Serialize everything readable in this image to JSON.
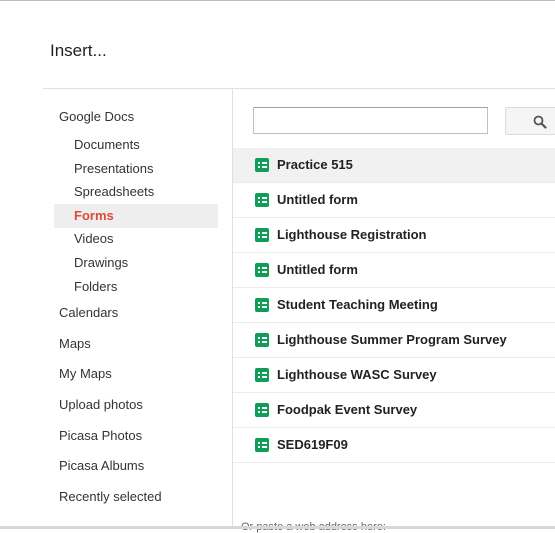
{
  "dialog": {
    "title": "Insert..."
  },
  "sidebar": {
    "section_label": "Google Docs",
    "sub_items": [
      {
        "label": "Documents"
      },
      {
        "label": "Presentations"
      },
      {
        "label": "Spreadsheets"
      },
      {
        "label": "Forms",
        "active": true
      },
      {
        "label": "Videos"
      },
      {
        "label": "Drawings"
      },
      {
        "label": "Folders"
      }
    ],
    "top_items": [
      {
        "label": "Calendars"
      },
      {
        "label": "Maps"
      },
      {
        "label": "My Maps"
      },
      {
        "label": "Upload photos"
      },
      {
        "label": "Picasa Photos"
      },
      {
        "label": "Picasa Albums"
      },
      {
        "label": "Recently selected"
      }
    ]
  },
  "search": {
    "value": "",
    "button_icon": "search-icon"
  },
  "files": [
    {
      "name": "Practice 515",
      "selected": true,
      "icon": "form-icon"
    },
    {
      "name": "Untitled form",
      "icon": "form-icon"
    },
    {
      "name": "Lighthouse Registration",
      "icon": "form-icon"
    },
    {
      "name": "Untitled form",
      "icon": "form-icon"
    },
    {
      "name": "Student Teaching Meeting",
      "icon": "form-icon"
    },
    {
      "name": "Lighthouse Summer Program Survey",
      "icon": "form-icon"
    },
    {
      "name": "Lighthouse WASC Survey",
      "icon": "form-icon"
    },
    {
      "name": "Foodpak Event Survey",
      "icon": "form-icon"
    },
    {
      "name": "SED619F09",
      "icon": "form-icon"
    }
  ],
  "footer": {
    "paste_hint": "Or paste a web address here:"
  },
  "colors": {
    "active": "#dd4b39",
    "form_icon": "#0f9d58",
    "selected_row": "#f1f1f1"
  }
}
